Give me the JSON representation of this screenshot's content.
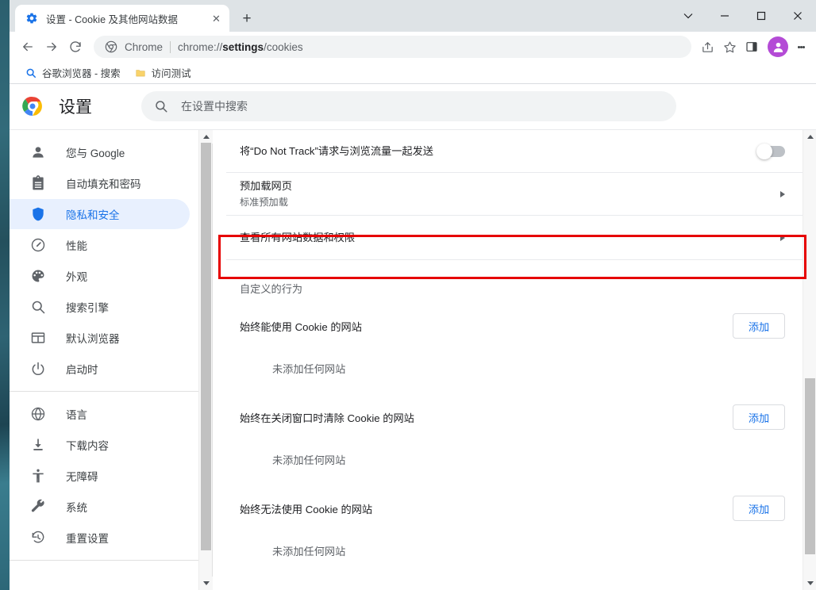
{
  "window": {
    "controls": [
      {
        "name": "tab-search",
        "glyph": "chevron-down"
      },
      {
        "name": "minimize",
        "glyph": "minus"
      },
      {
        "name": "maximize",
        "glyph": "square"
      },
      {
        "name": "close",
        "glyph": "cross"
      }
    ]
  },
  "tab": {
    "title": "设置 - Cookie 及其他网站数据",
    "favicon": "gear-icon",
    "close_label": "✕",
    "new_tab_label": "+"
  },
  "toolbar": {
    "back_label": "后退",
    "forward_label": "前进",
    "reload_label": "重新加载",
    "omnibox": {
      "scheme_chip": "Chrome",
      "url_prefix": "chrome://",
      "url_bold": "settings",
      "url_suffix": "/cookies",
      "full_url": "chrome://settings/cookies"
    },
    "share_label": "分享",
    "bookmark_label": "收藏",
    "side_panel_label": "侧边栏",
    "avatar_label": "个人资料",
    "menu_label": "自定义及控制"
  },
  "bookmarks": [
    {
      "label": "谷歌浏览器 - 搜索",
      "icon": "search-icon"
    },
    {
      "label": "访问测试",
      "icon": "folder-icon"
    }
  ],
  "settings_header": {
    "logo": "chrome-logo",
    "title": "设置",
    "search_placeholder": "在设置中搜索",
    "search_value": ""
  },
  "sidebar": {
    "groups": [
      {
        "items": [
          {
            "label": "您与 Google",
            "icon": "person-icon",
            "selected": false
          },
          {
            "label": "自动填充和密码",
            "icon": "clipboard-icon",
            "selected": false
          },
          {
            "label": "隐私和安全",
            "icon": "shield-icon",
            "selected": true
          },
          {
            "label": "性能",
            "icon": "speedometer-icon",
            "selected": false
          },
          {
            "label": "外观",
            "icon": "palette-icon",
            "selected": false
          },
          {
            "label": "搜索引擎",
            "icon": "search-icon",
            "selected": false
          },
          {
            "label": "默认浏览器",
            "icon": "browser-window-icon",
            "selected": false
          },
          {
            "label": "启动时",
            "icon": "power-icon",
            "selected": false
          }
        ]
      },
      {
        "items": [
          {
            "label": "语言",
            "icon": "globe-icon",
            "selected": false
          },
          {
            "label": "下载内容",
            "icon": "download-icon",
            "selected": false
          },
          {
            "label": "无障碍",
            "icon": "accessibility-icon",
            "selected": false
          },
          {
            "label": "系统",
            "icon": "wrench-icon",
            "selected": false
          },
          {
            "label": "重置设置",
            "icon": "history-icon",
            "selected": false
          }
        ]
      }
    ]
  },
  "main": {
    "do_not_track": {
      "title": "将“Do Not Track”请求与浏览流量一起发送",
      "toggle_on": false
    },
    "preload": {
      "title": "预加载网页",
      "subtitle": "标准预加载"
    },
    "all_site_data": {
      "title": "查看所有网站数据和权限",
      "highlighted": true,
      "highlight_color": "#e60000"
    },
    "custom_behavior_label": "自定义的行为",
    "cookie_sections": [
      {
        "label": "始终能使用 Cookie 的网站",
        "button": "添加",
        "empty_note": "未添加任何网站"
      },
      {
        "label": "始终在关闭窗口时清除 Cookie 的网站",
        "button": "添加",
        "empty_note": "未添加任何网站"
      },
      {
        "label": "始终无法使用 Cookie 的网站",
        "button": "添加",
        "empty_note": "未添加任何网站"
      }
    ]
  },
  "colors": {
    "accent": "#1a73e8",
    "selected_nav_bg": "#e8f0fe",
    "highlight": "#e60000",
    "avatar_bg": "#b44bd6",
    "titlebar_bg": "#dee3e6"
  }
}
